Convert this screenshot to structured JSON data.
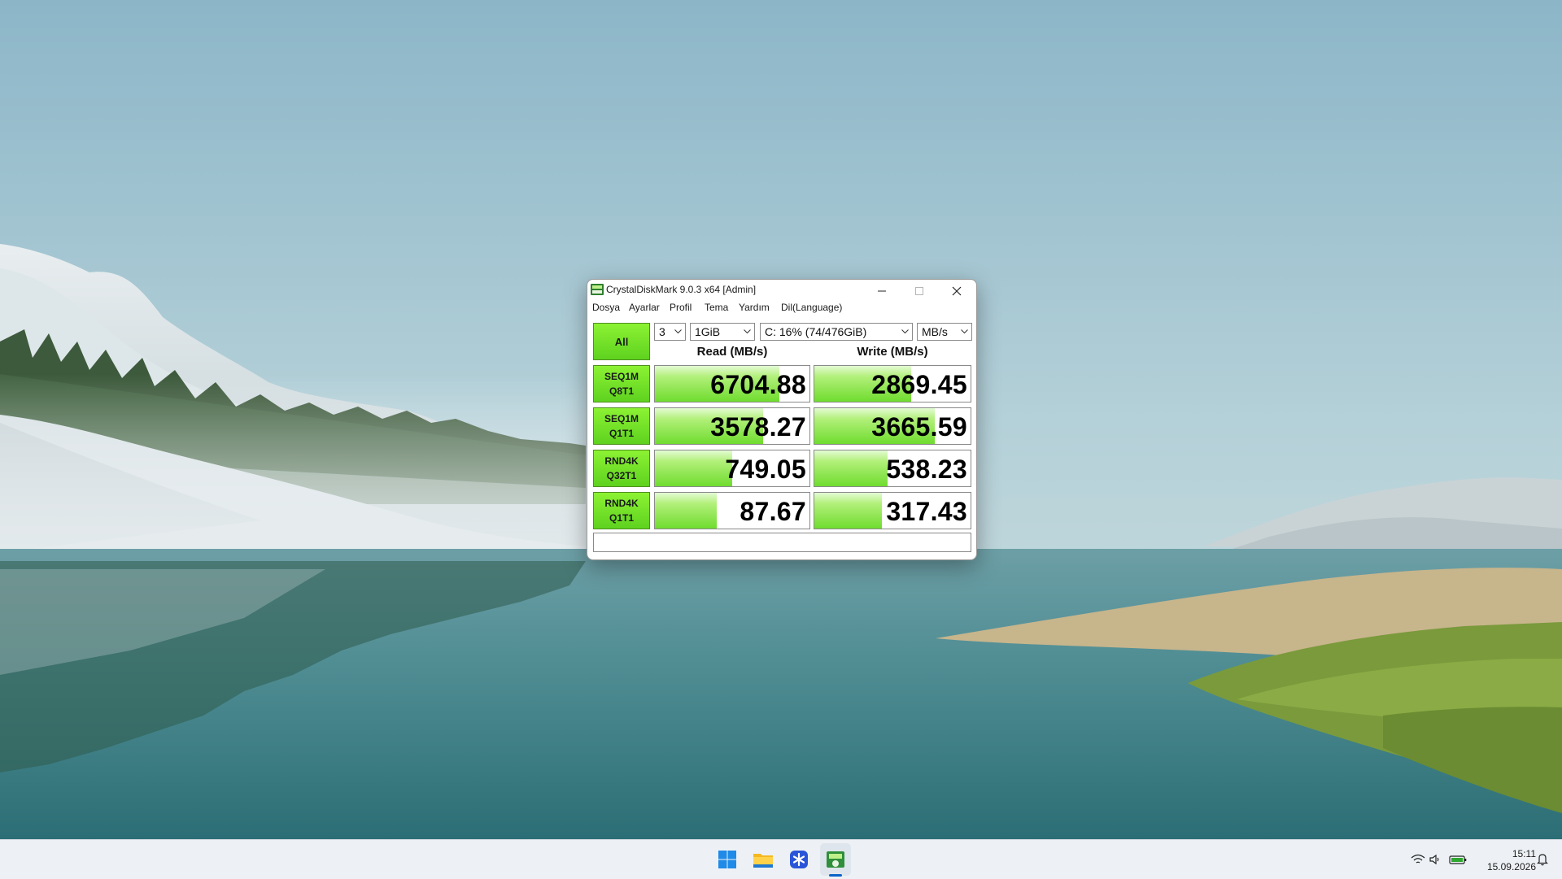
{
  "window": {
    "title": "CrystalDiskMark 9.0.3 x64 [Admin]",
    "menu": [
      "Dosya",
      "Ayarlar",
      "Profil",
      "Tema",
      "Yardım",
      "Dil(Language)"
    ]
  },
  "controls": {
    "all_label": "All",
    "count": "3",
    "size": "1GiB",
    "drive": "C: 16% (74/476GiB)",
    "unit": "MB/s"
  },
  "headers": {
    "read": "Read (MB/s)",
    "write": "Write (MB/s)"
  },
  "tests": [
    {
      "line1": "SEQ1M",
      "line2": "Q8T1",
      "read": "6704.88",
      "write": "2869.45",
      "read_fill": 0.805,
      "write_fill": 0.62
    },
    {
      "line1": "SEQ1M",
      "line2": "Q1T1",
      "read": "3578.27",
      "write": "3665.59",
      "read_fill": 0.7,
      "write_fill": 0.77
    },
    {
      "line1": "RND4K",
      "line2": "Q32T1",
      "read": "749.05",
      "write": "538.23",
      "read_fill": 0.5,
      "write_fill": 0.47
    },
    {
      "line1": "RND4K",
      "line2": "Q1T1",
      "read": "87.67",
      "write": "317.43",
      "read_fill": 0.4,
      "write_fill": 0.43
    }
  ],
  "comment": "",
  "taskbar": {
    "apps": [
      "start-icon",
      "file-explorer-icon",
      "snowflake-app-icon",
      "crystaldiskmark-icon"
    ],
    "time": "15:11",
    "date": "15.09.2026"
  },
  "colors": {
    "accent_green": "#6fdc2e",
    "button_green": "#7be82a",
    "taskbar": "#edf1f5"
  }
}
